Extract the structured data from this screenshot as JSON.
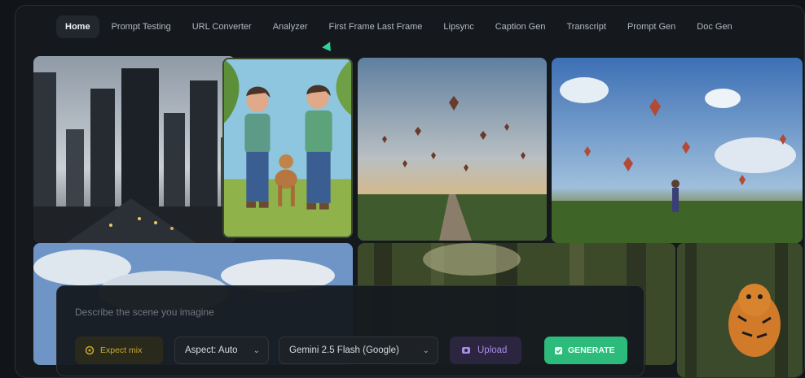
{
  "nav": {
    "tabs": [
      {
        "label": "Home",
        "active": true
      },
      {
        "label": "Prompt Testing"
      },
      {
        "label": "URL Converter"
      },
      {
        "label": "Analyzer"
      },
      {
        "label": "First Frame Last Frame"
      },
      {
        "label": "Lipsync"
      },
      {
        "label": "Caption Gen"
      },
      {
        "label": "Transcript"
      },
      {
        "label": "Prompt Gen"
      },
      {
        "label": "Doc Gen"
      }
    ]
  },
  "prompt": {
    "placeholder": "Describe the scene you imagine"
  },
  "controls": {
    "expect_label": "Expect mix",
    "aspect_label": "Aspect: Auto",
    "model_label": "Gemini 2.5 Flash (Google)",
    "upload_label": "Upload",
    "generate_label": "GENERATE"
  },
  "colors": {
    "accent_green": "#2cbb7a",
    "upload_purple": "#a88ce6",
    "expect_gold": "#c7a92d"
  }
}
